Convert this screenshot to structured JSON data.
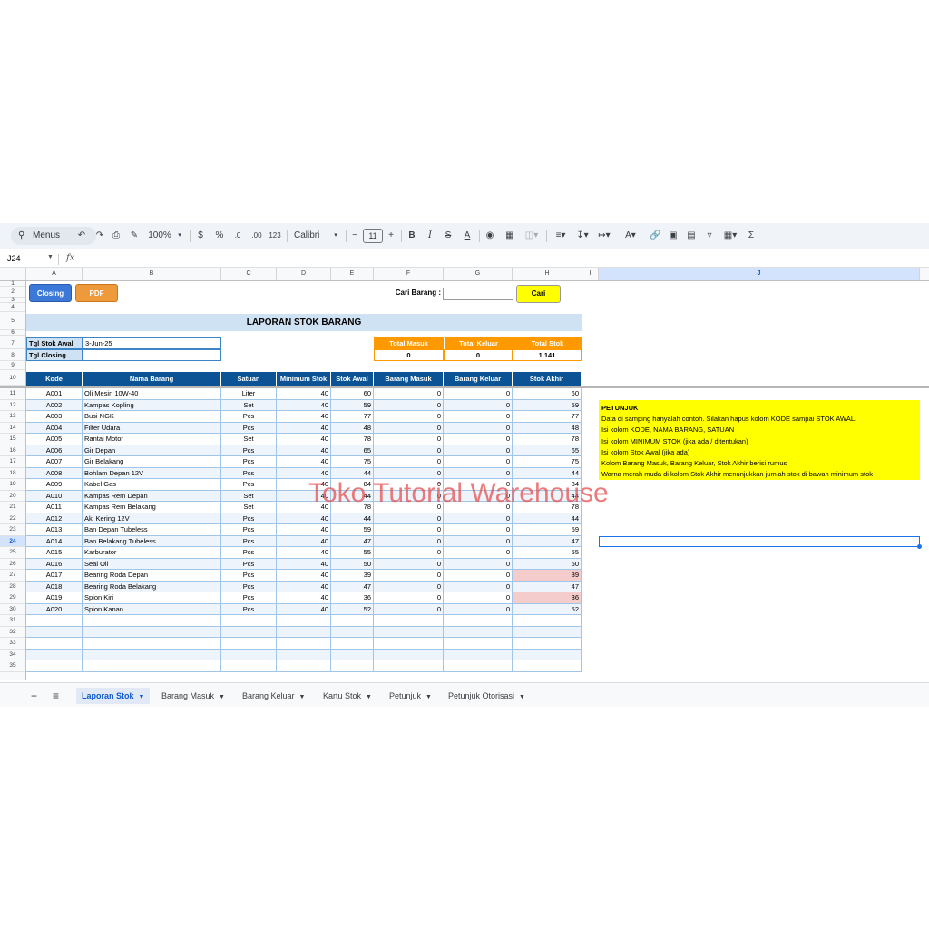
{
  "toolbar": {
    "menus": "Menus",
    "zoom": "100%",
    "currency": "$",
    "percent": "%",
    "dec_minus": ".0",
    "dec_plus": ".00",
    "format123": "123",
    "font": "Calibri",
    "font_size": "11",
    "bold": "B",
    "italic": "I",
    "strike": "S",
    "textcolor": "A",
    "sigma": "Σ"
  },
  "formula_bar": {
    "cell_ref": "J24",
    "fx": "fx"
  },
  "columns": [
    "A",
    "B",
    "C",
    "D",
    "E",
    "F",
    "G",
    "H",
    "I",
    "J"
  ],
  "rows": [
    "1",
    "2",
    "3",
    "4",
    "5",
    "6",
    "7",
    "8",
    "9",
    "10",
    "11",
    "12",
    "13",
    "14",
    "15",
    "16",
    "17",
    "18",
    "19",
    "20",
    "21",
    "22",
    "23",
    "24",
    "25",
    "26",
    "27",
    "28",
    "29",
    "30",
    "31",
    "32",
    "33",
    "34",
    "35"
  ],
  "buttons": {
    "closing": "Closing",
    "pdf": "PDF",
    "cari": "Cari"
  },
  "search": {
    "label": "Cari Barang :",
    "value": ""
  },
  "title": "LAPORAN STOK BARANG",
  "info": {
    "tgl_awal_label": "Tgl Stok Awal",
    "tgl_awal_value": "3-Jun-25",
    "tgl_closing_label": "Tgl Closing",
    "tgl_closing_value": ""
  },
  "totals": {
    "masuk_label": "Total Masuk",
    "keluar_label": "Total Keluar",
    "stok_label": "Total Stok",
    "masuk_value": "0",
    "keluar_value": "0",
    "stok_value": "1.141"
  },
  "table_headers": [
    "Kode",
    "Nama Barang",
    "Satuan",
    "Minimum Stok",
    "Stok Awal",
    "Barang Masuk",
    "Barang Keluar",
    "Stok Akhir"
  ],
  "table_rows": [
    [
      "A001",
      "Oli Mesin 10W-40",
      "Liter",
      "40",
      "60",
      "0",
      "0",
      "60"
    ],
    [
      "A002",
      "Kampas Kopling",
      "Set",
      "40",
      "59",
      "0",
      "0",
      "59"
    ],
    [
      "A003",
      "Busi NGK",
      "Pcs",
      "40",
      "77",
      "0",
      "0",
      "77"
    ],
    [
      "A004",
      "Filter Udara",
      "Pcs",
      "40",
      "48",
      "0",
      "0",
      "48"
    ],
    [
      "A005",
      "Rantai Motor",
      "Set",
      "40",
      "78",
      "0",
      "0",
      "78"
    ],
    [
      "A006",
      "Gir Depan",
      "Pcs",
      "40",
      "65",
      "0",
      "0",
      "65"
    ],
    [
      "A007",
      "Gir Belakang",
      "Pcs",
      "40",
      "75",
      "0",
      "0",
      "75"
    ],
    [
      "A008",
      "Bohlam Depan 12V",
      "Pcs",
      "40",
      "44",
      "0",
      "0",
      "44"
    ],
    [
      "A009",
      "Kabel Gas",
      "Pcs",
      "40",
      "84",
      "0",
      "0",
      "84"
    ],
    [
      "A010",
      "Kampas Rem Depan",
      "Set",
      "40",
      "44",
      "0",
      "0",
      "44"
    ],
    [
      "A011",
      "Kampas Rem Belakang",
      "Set",
      "40",
      "78",
      "0",
      "0",
      "78"
    ],
    [
      "A012",
      "Aki Kering 12V",
      "Pcs",
      "40",
      "44",
      "0",
      "0",
      "44"
    ],
    [
      "A013",
      "Ban Depan Tubeless",
      "Pcs",
      "40",
      "59",
      "0",
      "0",
      "59"
    ],
    [
      "A014",
      "Ban Belakang Tubeless",
      "Pcs",
      "40",
      "47",
      "0",
      "0",
      "47"
    ],
    [
      "A015",
      "Karburator",
      "Pcs",
      "40",
      "55",
      "0",
      "0",
      "55"
    ],
    [
      "A016",
      "Seal Oli",
      "Pcs",
      "40",
      "50",
      "0",
      "0",
      "50"
    ],
    [
      "A017",
      "Bearing Roda Depan",
      "Pcs",
      "40",
      "39",
      "0",
      "0",
      "39"
    ],
    [
      "A018",
      "Bearing Roda Belakang",
      "Pcs",
      "40",
      "47",
      "0",
      "0",
      "47"
    ],
    [
      "A019",
      "Spion Kiri",
      "Pcs",
      "40",
      "36",
      "0",
      "0",
      "36"
    ],
    [
      "A020",
      "Spion Kanan",
      "Pcs",
      "40",
      "52",
      "0",
      "0",
      "52"
    ]
  ],
  "low_stock_color": "#f4cccc",
  "petunjuk": {
    "title": "PETUNJUK",
    "lines": [
      "Data di samping hanyalah contoh. Silakan hapus kolom KODE sampai STOK AWAL.",
      "Isi kolom KODE, NAMA BARANG, SATUAN",
      "Isi kolom MINIMUM STOK (jika ada / ditentukan)",
      "Isi kolom Stok Awal (jika ada)",
      "Kolom Barang Masuk, Barang Keluar, Stok Akhir berisi rumus",
      "Warna merah muda di kolom Stok Akhir menunjukkan jumlah stok di bawah minimum stok"
    ]
  },
  "watermark": "Toko Tutorial Warehouse",
  "tabs": [
    "Laporan Stok",
    "Barang Masuk",
    "Barang Keluar",
    "Kartu Stok",
    "Petunjuk",
    "Petunjuk Otorisasi"
  ],
  "tab_add": "+",
  "tab_menu": "≡"
}
